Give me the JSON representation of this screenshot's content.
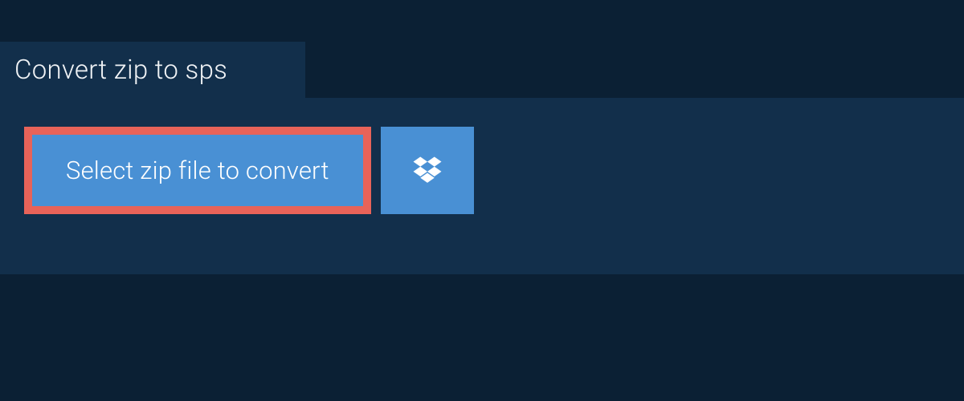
{
  "tab": {
    "title": "Convert zip to sps"
  },
  "actions": {
    "select_file_label": "Select zip file to convert",
    "cloud_provider": "dropbox"
  },
  "colors": {
    "page_bg": "#0b2034",
    "panel_bg": "#122f4b",
    "button_bg": "#4990d4",
    "highlight_border": "#e86359",
    "text_light": "#f0f3f6"
  }
}
